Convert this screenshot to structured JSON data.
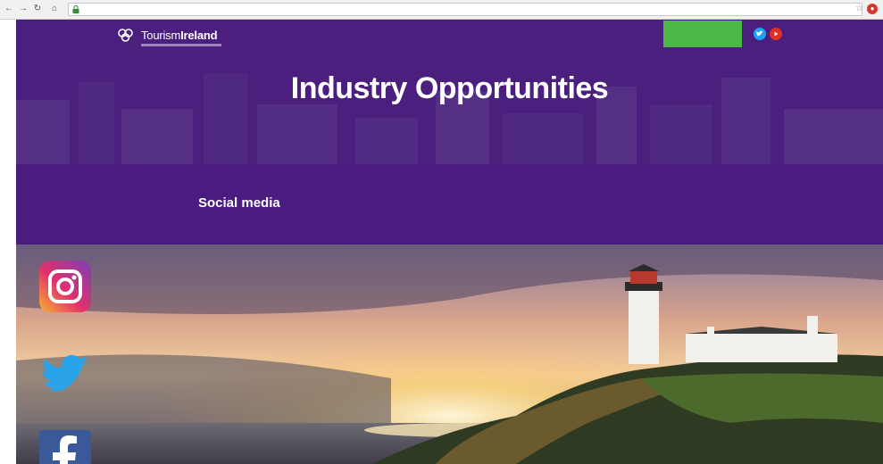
{
  "browser": {
    "url": "",
    "icons": [
      "back-arrow-icon",
      "forward-arrow-icon",
      "reload-icon",
      "lock-icon",
      "star-icon",
      "extension-icon"
    ]
  },
  "site": {
    "logo": {
      "text_a": "Tourism",
      "text_b": "Ireland"
    },
    "nav": [
      "",
      "",
      "",
      ""
    ],
    "cta": [
      "",
      ""
    ],
    "social_header": [
      "twitter-icon",
      "youtube-icon"
    ]
  },
  "hero": {
    "title": "Industry Opportunities",
    "subtitle": ""
  },
  "section": {
    "title": "Social media"
  },
  "social_links": [
    "instagram-icon",
    "twitter-icon",
    "facebook-icon"
  ],
  "colors": {
    "hero_purple": "#4a1f7d",
    "cta_green": "#4db848",
    "twitter_blue": "#1da1f2",
    "youtube_red": "#e52d27",
    "facebook_blue": "#3b5998"
  }
}
